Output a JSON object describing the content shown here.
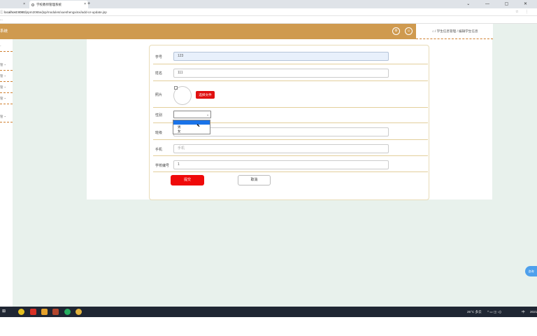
{
  "browser": {
    "tab1_label": "",
    "tab2_label": "学校教师管理系统",
    "url_host": "localhost:8080",
    "url_path": "/jspm2065e/jsp/modules/xueshengxinxi/add-or-update.jsp",
    "bookmark": "..."
  },
  "app": {
    "title": "系统",
    "breadcrumb": "⌂ / 学生信息管理 / 编辑学生信息"
  },
  "sidebar": {
    "items": [
      "-",
      "管 ~",
      "管 ~",
      "管 ~",
      "管 ~",
      "管 ~"
    ]
  },
  "form": {
    "student_no_label": "学号",
    "student_no_value": "123",
    "name_label": "姓名",
    "name_value": "111",
    "photo_label": "照片",
    "upload_label": "选择文件",
    "gender_label": "性别",
    "gender_selected": "",
    "gender_options": [
      "男",
      "女"
    ],
    "class_label": "班级",
    "class_value": "",
    "phone_label": "手机",
    "phone_placeholder": "手机",
    "school_no_label": "学校编号",
    "school_no_value": "1",
    "submit_label": "提交",
    "cancel_label": "取消"
  },
  "chat_widget": "咨询",
  "taskbar": {
    "weather": "25°C 多云",
    "ime": "中",
    "clock": "2021"
  },
  "colors": {
    "header": "#cf9a4f",
    "primary_button": "#ef0a0a",
    "background": "#e8f1ec",
    "dropdown_highlight": "#1a73e8"
  }
}
